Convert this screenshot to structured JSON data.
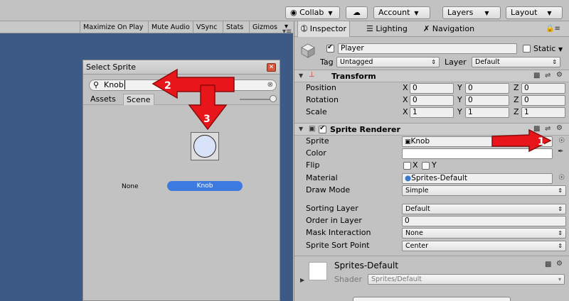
{
  "toolbar": {
    "collab": "Collab",
    "account": "Account",
    "layers": "Layers",
    "layout": "Layout"
  },
  "game_view": {
    "buttons": [
      "Maximize On Play",
      "Mute Audio",
      "VSync",
      "Stats",
      "Gizmos"
    ]
  },
  "picker": {
    "title": "Select Sprite",
    "search_value": "Knob",
    "tabs": [
      "Assets",
      "Scene"
    ],
    "none_label": "None",
    "selected_label": "Knob",
    "steps": [
      "2",
      "3"
    ]
  },
  "inspector": {
    "tabs": [
      "Inspector",
      "Lighting",
      "Navigation"
    ],
    "object_name": "Player",
    "static_label": "Static",
    "tag_label": "Tag",
    "tag_value": "Untagged",
    "layer_label": "Layer",
    "layer_value": "Default",
    "transform": {
      "title": "Transform",
      "rows": [
        {
          "label": "Position",
          "x": "0",
          "y": "0",
          "z": "0"
        },
        {
          "label": "Rotation",
          "x": "0",
          "y": "0",
          "z": "0"
        },
        {
          "label": "Scale",
          "x": "1",
          "y": "1",
          "z": "1"
        }
      ],
      "axes": [
        "X",
        "Y",
        "Z"
      ]
    },
    "sprite_renderer": {
      "title": "Sprite Renderer",
      "sprite_label": "Sprite",
      "sprite_value": "Knob",
      "color_label": "Color",
      "flip_label": "Flip",
      "flip_x": "X",
      "flip_y": "Y",
      "material_label": "Material",
      "material_value": "Sprites-Default",
      "draw_mode_label": "Draw Mode",
      "draw_mode_value": "Simple",
      "sorting_layer_label": "Sorting Layer",
      "sorting_layer_value": "Default",
      "order_label": "Order in Layer",
      "order_value": "0",
      "mask_label": "Mask Interaction",
      "mask_value": "None",
      "sort_point_label": "Sprite Sort Point",
      "sort_point_value": "Center",
      "step": "1"
    },
    "material": {
      "name": "Sprites-Default",
      "shader_label": "Shader",
      "shader_value": "Sprites/Default"
    }
  },
  "colors": {
    "arrow_red": "#e8161b",
    "selected_blue": "#3d7ae0",
    "game_view_bg": "#3c5a85"
  }
}
